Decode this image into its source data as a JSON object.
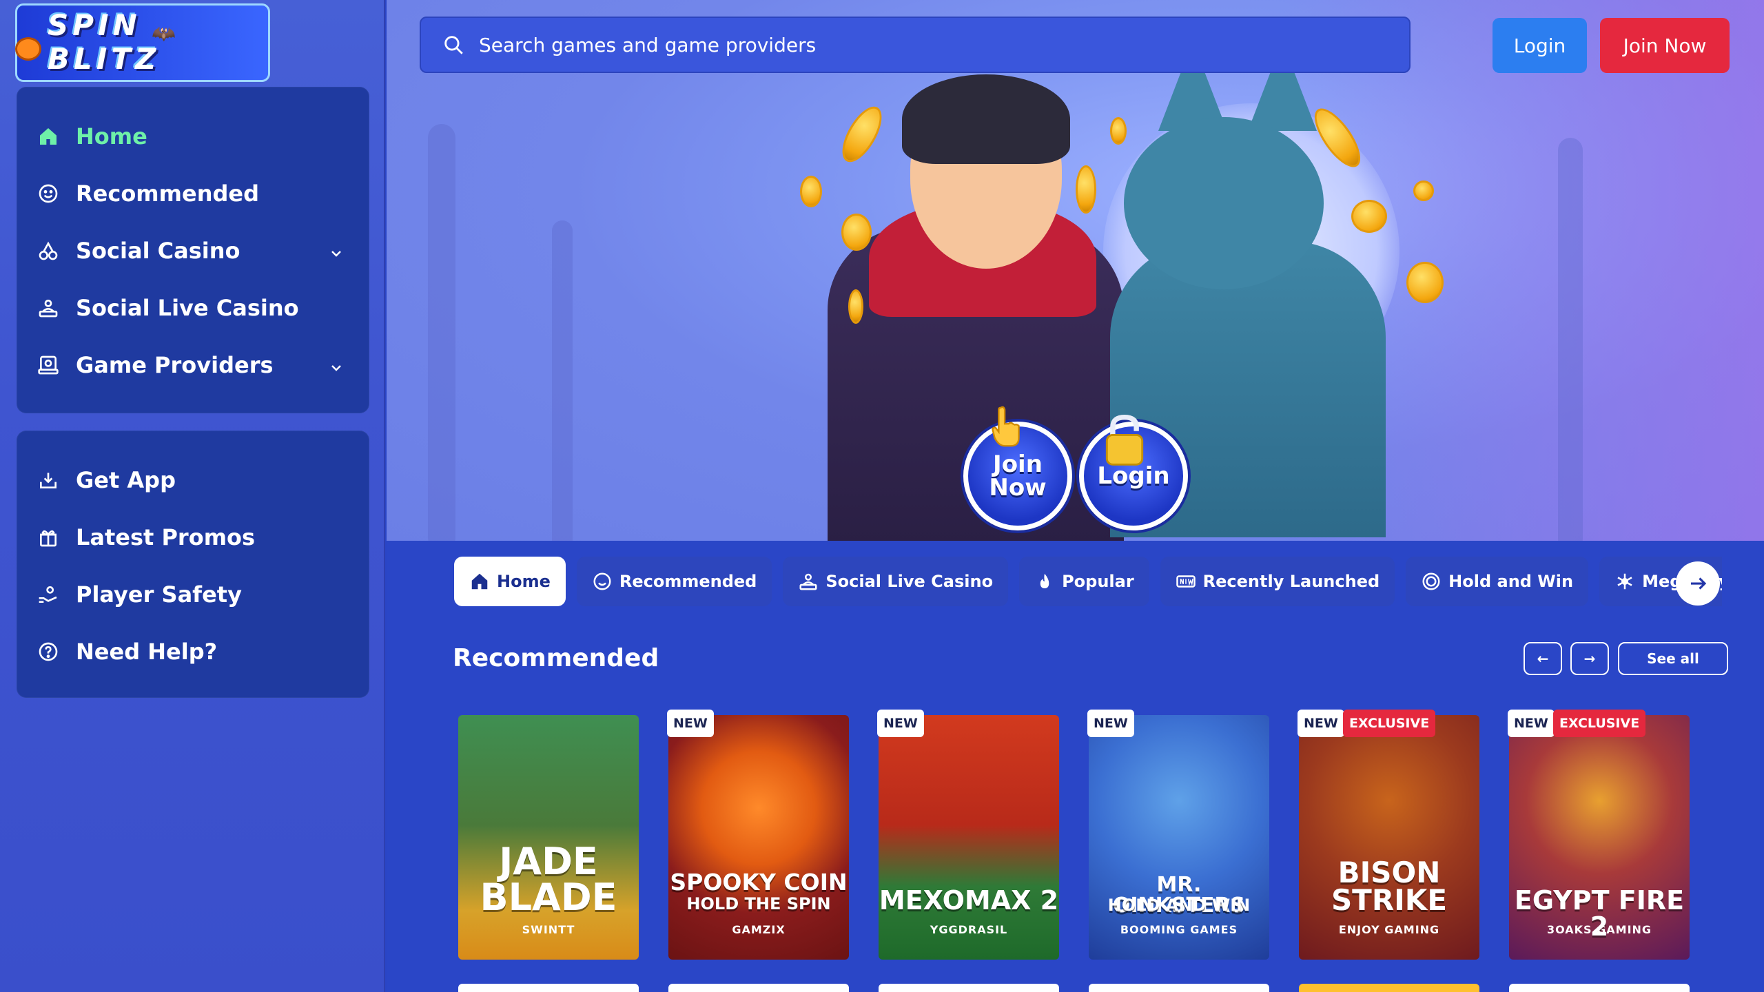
{
  "brand": {
    "logo_text": "SPIN BLITZ"
  },
  "sidebar": {
    "nav_items": [
      {
        "label": "Home",
        "icon": "home-icon",
        "active": true
      },
      {
        "label": "Recommended",
        "icon": "smile-icon"
      },
      {
        "label": "Social Casino",
        "icon": "cherries-icon",
        "expandable": true
      },
      {
        "label": "Social Live Casino",
        "icon": "dealer-icon"
      },
      {
        "label": "Game Providers",
        "icon": "provider-icon",
        "expandable": true
      }
    ],
    "extra_items": [
      {
        "label": "Get App",
        "icon": "download-icon"
      },
      {
        "label": "Latest Promos",
        "icon": "gift-icon"
      },
      {
        "label": "Player Safety",
        "icon": "safety-hand-icon"
      },
      {
        "label": "Need Help?",
        "icon": "help-circle-icon"
      }
    ]
  },
  "header": {
    "search_placeholder": "Search games and game providers",
    "login_label": "Login",
    "join_label": "Join Now"
  },
  "hero": {
    "join_label_1": "Join",
    "join_label_2": "Now",
    "login_label": "Login"
  },
  "tabs": [
    {
      "label": "Home",
      "icon": "home-icon",
      "active": true
    },
    {
      "label": "Recommended",
      "icon": "smile-icon"
    },
    {
      "label": "Social Live Casino",
      "icon": "dealer-icon"
    },
    {
      "label": "Popular",
      "icon": "flame-icon"
    },
    {
      "label": "Recently Launched",
      "icon": "new-icon"
    },
    {
      "label": "Hold and Win",
      "icon": "coin-icon"
    },
    {
      "label": "Megaways",
      "icon": "snowflake-icon"
    }
  ],
  "section": {
    "title": "Recommended",
    "prev_label": "←",
    "next_label": "→",
    "see_all_label": "See all"
  },
  "games": [
    {
      "title_1": "JADE",
      "title_2": "BLADE",
      "provider": "SWINTT",
      "badges": []
    },
    {
      "title_1": "SPOOKY COIN",
      "title_2": "HOLD THE SPIN",
      "provider": "GAMZIX",
      "badges": [
        "NEW"
      ]
    },
    {
      "title_1": "MEXOMAX 2",
      "title_2": "",
      "provider": "YGGDRASIL",
      "badges": [
        "NEW"
      ]
    },
    {
      "title_1": "MR. OINKSTERS",
      "title_2": "HOLD AND WIN",
      "provider": "BOOMING GAMES",
      "badges": [
        "NEW"
      ]
    },
    {
      "title_1": "BISON",
      "title_2": "STRIKE",
      "provider": "ENJOY GAMING",
      "badges": [
        "NEW",
        "EXCLUSIVE"
      ]
    },
    {
      "title_1": "EGYPT FIRE 2",
      "title_2": "",
      "provider": "3OAKS GAMING",
      "badges": [
        "NEW",
        "EXCLUSIVE"
      ]
    }
  ],
  "colors": {
    "sidebar_panel": "#1f3aa0",
    "main_bg": "#2a46c7",
    "login_btn": "#2c7ef0",
    "join_btn": "#e5283e",
    "active_nav": "#6ef0a8"
  }
}
